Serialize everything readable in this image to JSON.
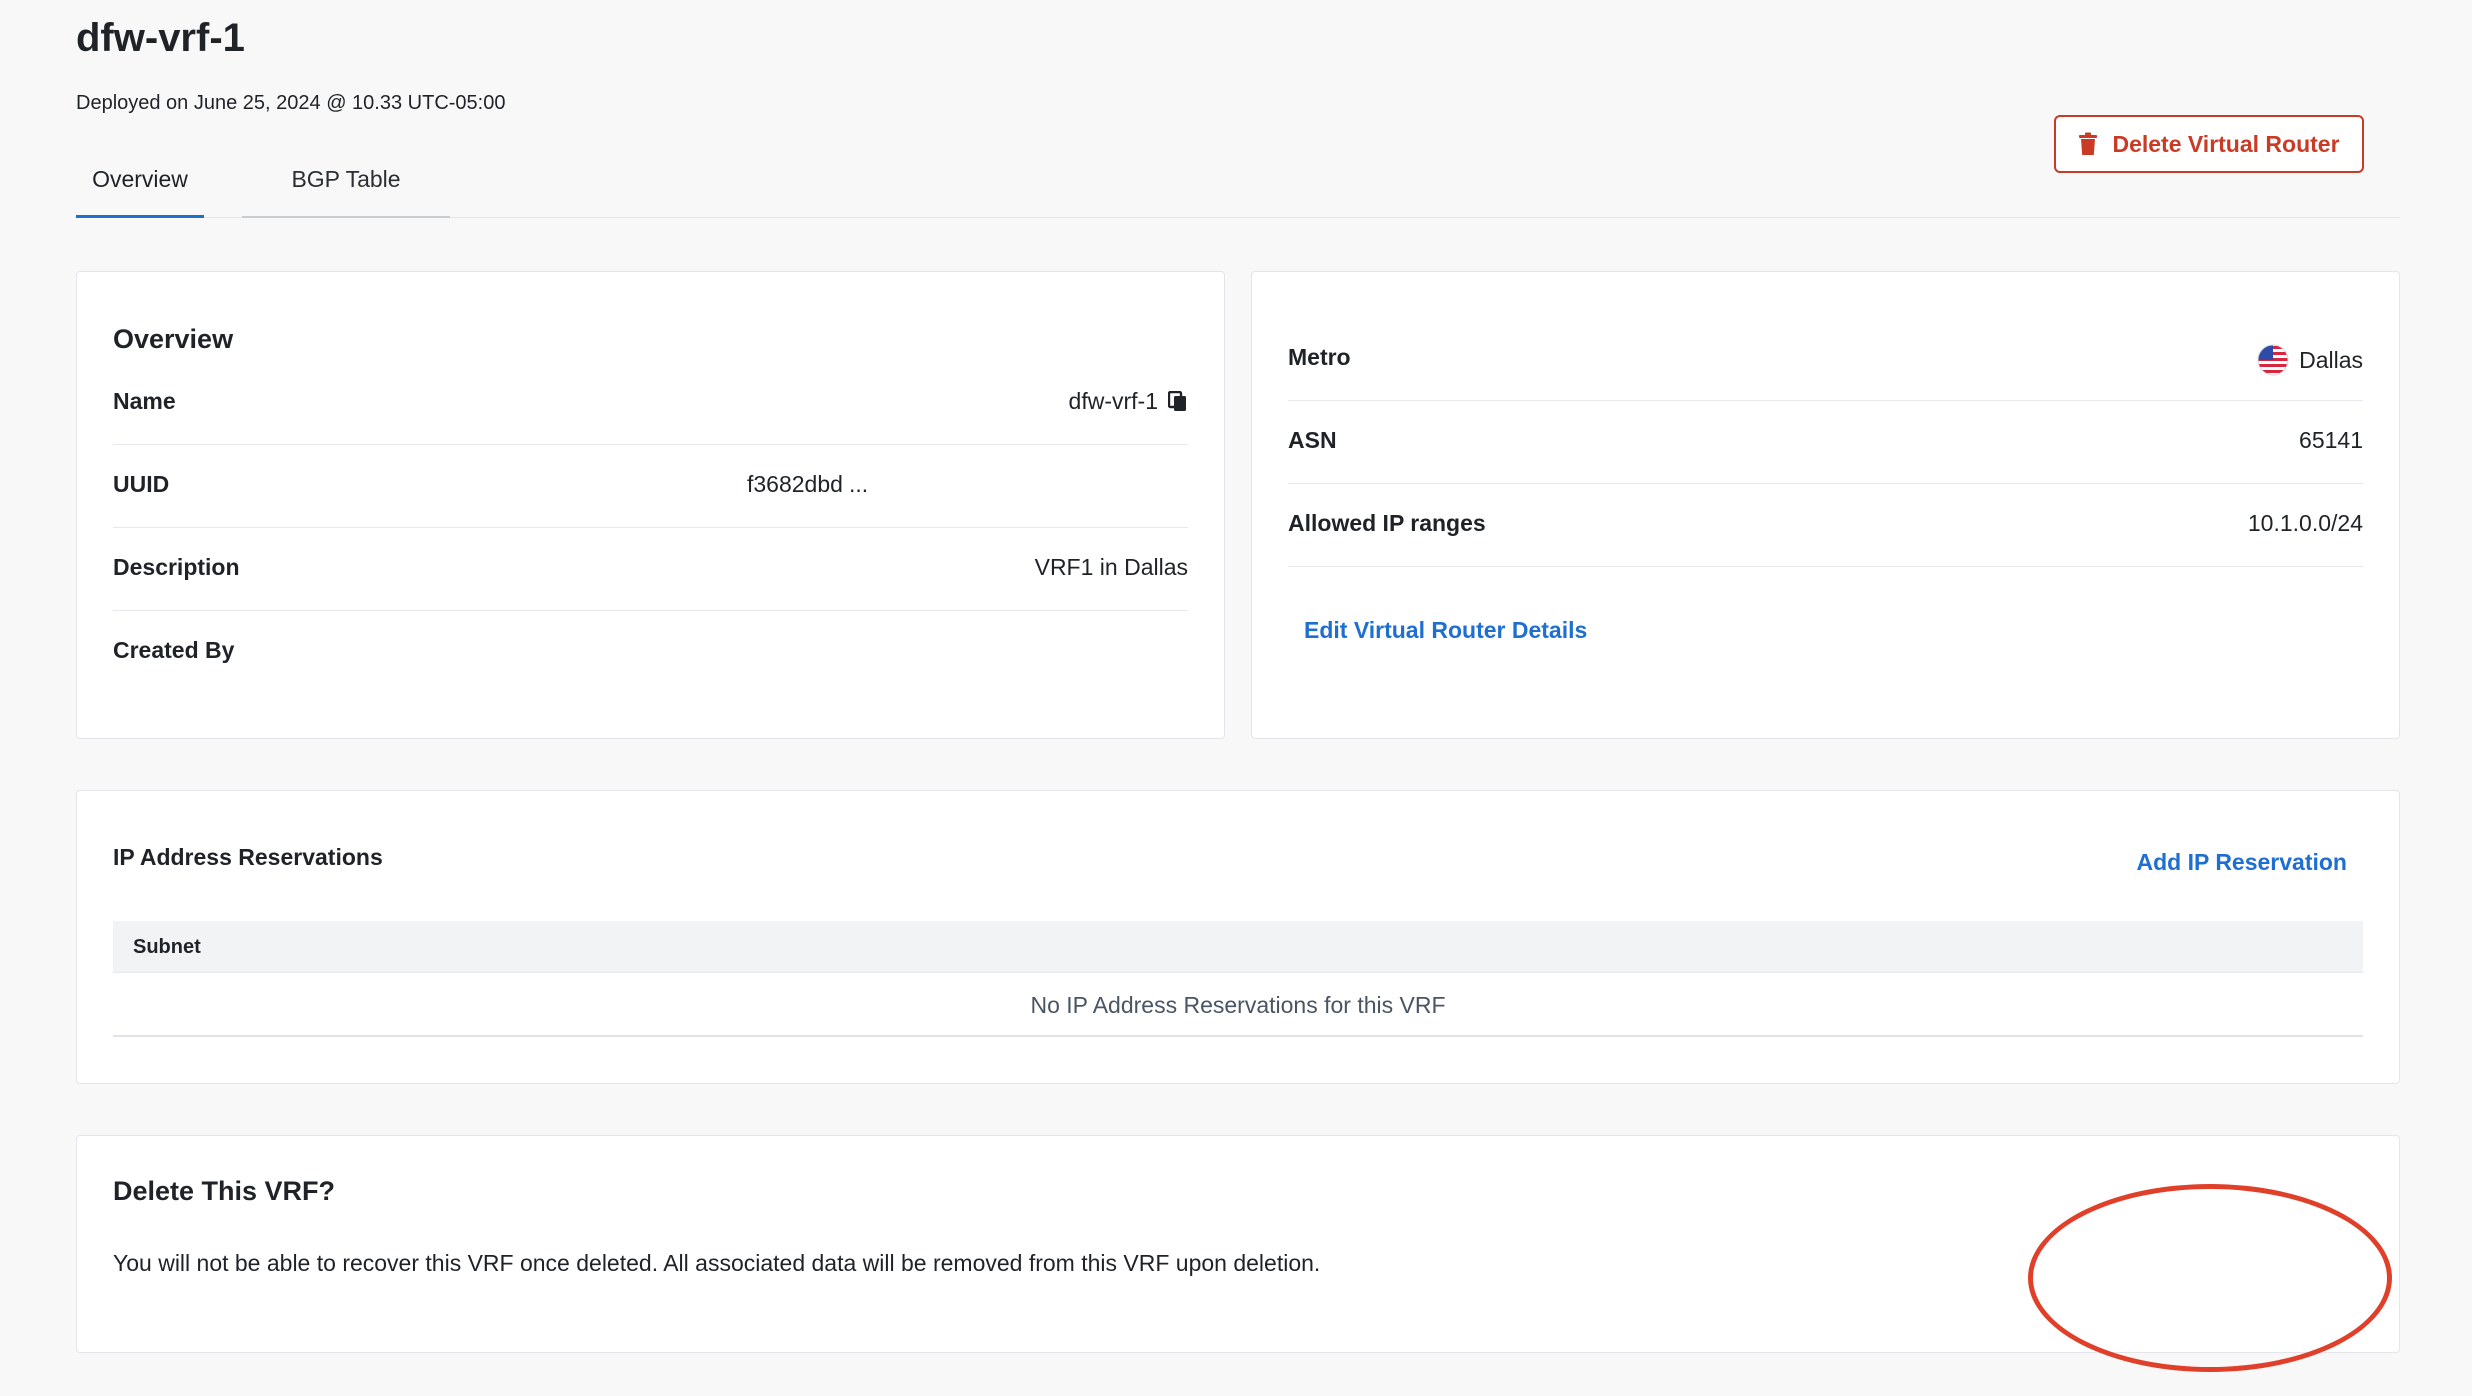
{
  "header": {
    "title": "dfw-vrf-1",
    "deployed": "Deployed on June 25, 2024 @ 10.33 UTC-05:00"
  },
  "tabs": [
    {
      "label": "Overview",
      "active": true
    },
    {
      "label": "BGP Table",
      "active": false
    }
  ],
  "overview": {
    "heading": "Overview",
    "rows": [
      {
        "label": "Name",
        "value": "dfw-vrf-1"
      },
      {
        "label": "UUID",
        "value": "f3682dbd",
        "ellipsis": "..."
      },
      {
        "label": "Description",
        "value": "VRF1 in Dallas"
      },
      {
        "label": "Created By",
        "value": ""
      }
    ]
  },
  "details": {
    "rows": [
      {
        "label": "Metro",
        "value": "Dallas",
        "icon": "us-flag-icon"
      },
      {
        "label": "ASN",
        "value": "65141"
      },
      {
        "label": "Allowed IP ranges",
        "value": "10.1.0.0/24"
      }
    ],
    "edit_link": "Edit Virtual Router Details"
  },
  "ip_reservations": {
    "title": "IP Address Reservations",
    "add_link": "Add IP Reservation",
    "columns": [
      "Subnet"
    ],
    "empty_message": "No IP Address Reservations for this VRF"
  },
  "delete": {
    "title": "Delete This VRF?",
    "text": "You will not be able to recover this VRF once deleted. All associated data will be removed from this VRF upon deletion.",
    "button": "Delete Virtual Router",
    "icon": "trash-icon"
  },
  "colors": {
    "link": "#1f6fd1",
    "danger": "#c93b25",
    "highlight": "#e0402a",
    "page_bg": "#f8f8f9"
  }
}
